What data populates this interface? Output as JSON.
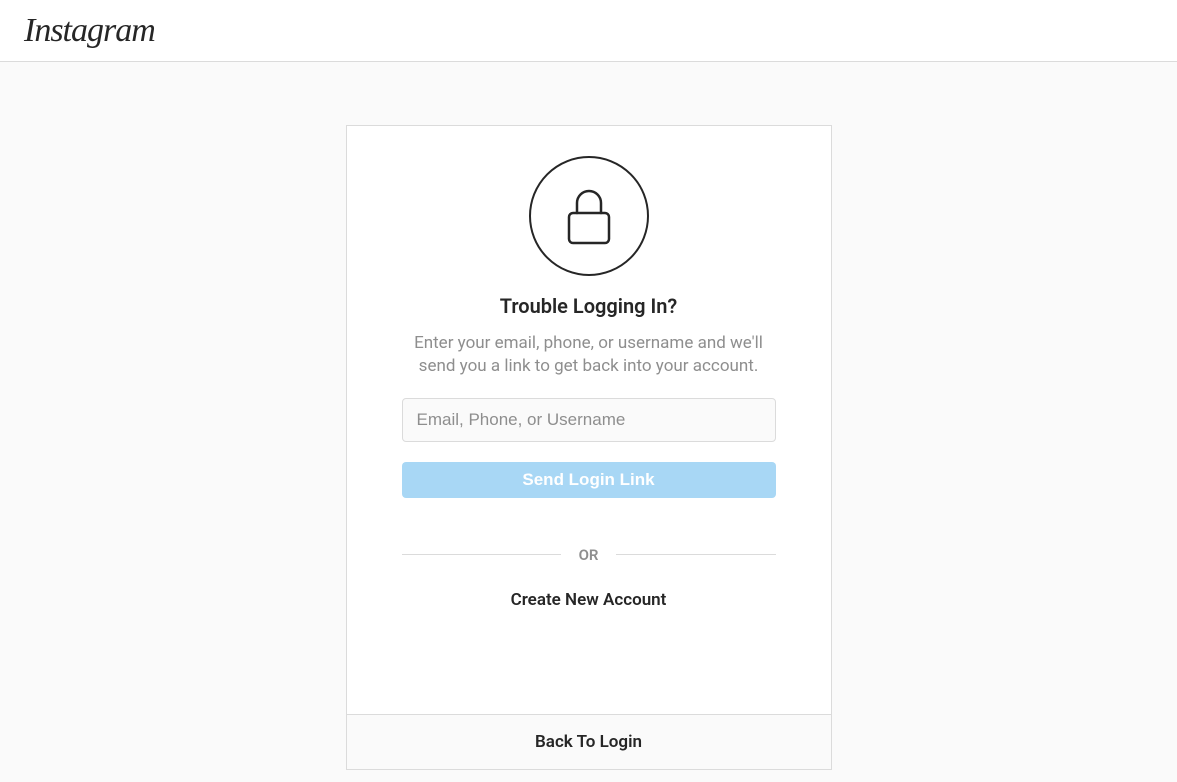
{
  "header": {
    "logo": "Instagram"
  },
  "card": {
    "title": "Trouble Logging In?",
    "subtitle": "Enter your email, phone, or username and we'll send you a link to get back into your account.",
    "input_placeholder": "Email, Phone, or Username",
    "input_value": "",
    "submit_label": "Send Login Link",
    "divider": "OR",
    "create_account": "Create New Account",
    "back_to_login": "Back To Login"
  }
}
